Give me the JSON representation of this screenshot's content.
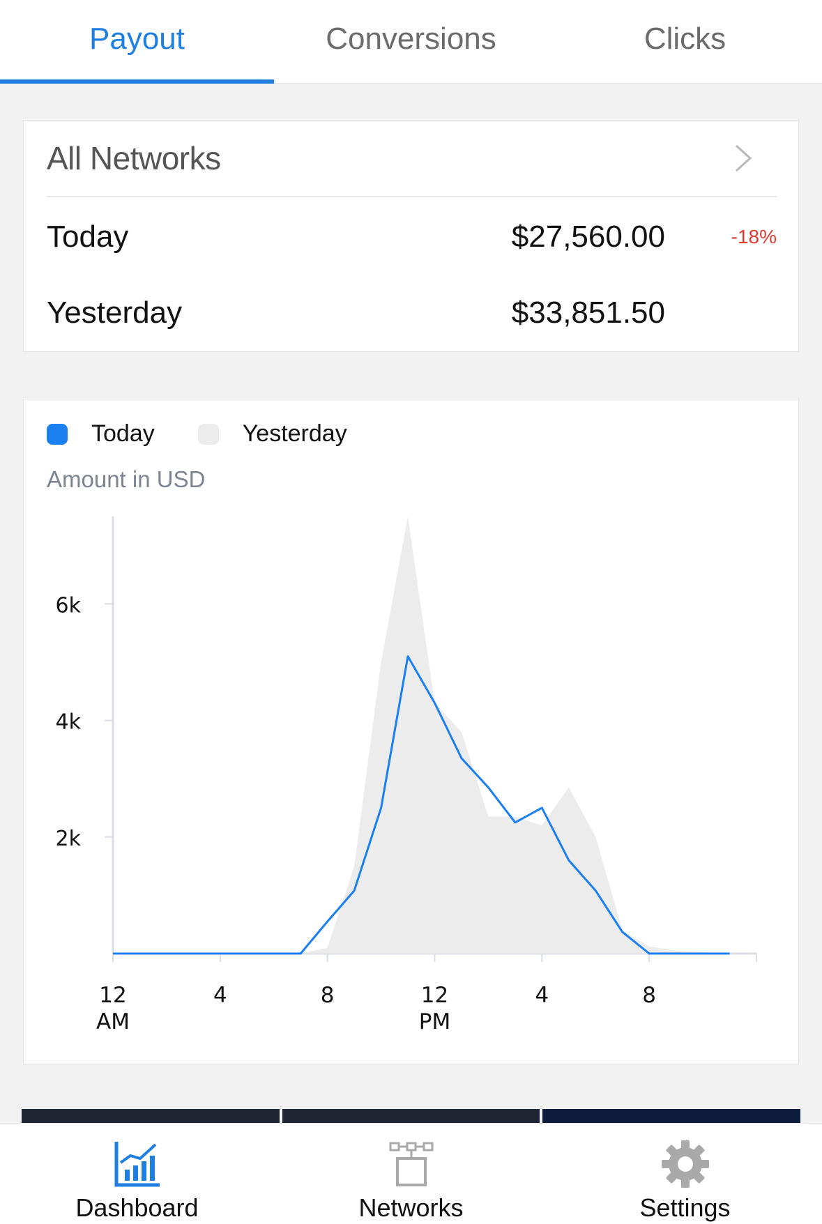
{
  "tabs": [
    {
      "label": "Payout",
      "active": true
    },
    {
      "label": "Conversions",
      "active": false
    },
    {
      "label": "Clicks",
      "active": false
    }
  ],
  "summary": {
    "network_label": "All Networks",
    "today_label": "Today",
    "today_value": "$27,560.00",
    "change": "-18%",
    "yesterday_label": "Yesterday",
    "yesterday_value": "$33,851.50"
  },
  "legend": {
    "today": "Today",
    "yesterday": "Yesterday",
    "today_color": "#1a7ff0",
    "yesterday_color": "#ececec"
  },
  "chart_label": "Amount in USD",
  "chart_data": {
    "type": "line",
    "title": "",
    "xlabel": "",
    "ylabel": "Amount in USD",
    "ylim": [
      0,
      7500
    ],
    "xlim": [
      0,
      24
    ],
    "y_ticks": [
      {
        "value": 2000,
        "label": "2k"
      },
      {
        "value": 4000,
        "label": "4k"
      },
      {
        "value": 6000,
        "label": "6k"
      }
    ],
    "x_ticks": [
      {
        "value": 0,
        "label": [
          "12",
          "AM"
        ]
      },
      {
        "value": 4,
        "label": [
          "4"
        ]
      },
      {
        "value": 8,
        "label": [
          "8"
        ]
      },
      {
        "value": 12,
        "label": [
          "12",
          "PM"
        ]
      },
      {
        "value": 16,
        "label": [
          "4"
        ]
      },
      {
        "value": 20,
        "label": [
          "8"
        ]
      }
    ],
    "series": [
      {
        "name": "Yesterday",
        "style": "area",
        "x": [
          0,
          7,
          8,
          9,
          10,
          11,
          12,
          13,
          14,
          15,
          16,
          17,
          18,
          19,
          20,
          21,
          22,
          23
        ],
        "y": [
          0,
          0,
          100,
          1500,
          5000,
          7500,
          4300,
          3800,
          2350,
          2350,
          2200,
          2850,
          2000,
          400,
          120,
          50,
          20,
          0
        ]
      },
      {
        "name": "Today",
        "style": "line",
        "x": [
          0,
          7,
          8,
          9,
          10,
          11,
          12,
          13,
          14,
          15,
          16,
          17,
          18,
          19,
          20,
          21,
          22,
          23
        ],
        "y": [
          0,
          0,
          550,
          1080,
          2500,
          5100,
          4300,
          3350,
          2850,
          2250,
          2500,
          1600,
          1080,
          370,
          0,
          0,
          0,
          0
        ]
      }
    ]
  },
  "nav": [
    {
      "label": "Dashboard",
      "icon": "dashboard-chart-icon",
      "active": true
    },
    {
      "label": "Networks",
      "icon": "network-icon",
      "active": false
    },
    {
      "label": "Settings",
      "icon": "gear-icon",
      "active": false
    }
  ]
}
